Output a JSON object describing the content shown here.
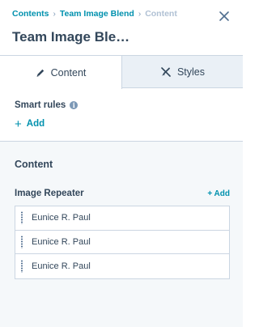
{
  "breadcrumb": {
    "items": [
      "Contents",
      "Team Image Blend"
    ],
    "current": "Content",
    "separator": "›"
  },
  "page_title": "Team Image Ble…",
  "tabs": [
    {
      "label": "Content",
      "icon": "pencil-icon",
      "active": true
    },
    {
      "label": "Styles",
      "icon": "brush-icon",
      "active": false
    }
  ],
  "smart_rules": {
    "label": "Smart rules",
    "info_icon": "info-icon",
    "add_label": "Add"
  },
  "content_section": {
    "heading": "Content",
    "repeater": {
      "label": "Image Repeater",
      "add_label": "+ Add",
      "items": [
        "Eunice R. Paul",
        "Eunice R. Paul",
        "Eunice R. Paul"
      ]
    }
  },
  "colors": {
    "link": "#0091ae",
    "text": "#33475b",
    "muted": "#b0c1d4",
    "border": "#cbd6e2",
    "panel_bg": "#f5f8fa",
    "tab_inactive_bg": "#eaf0f6"
  }
}
